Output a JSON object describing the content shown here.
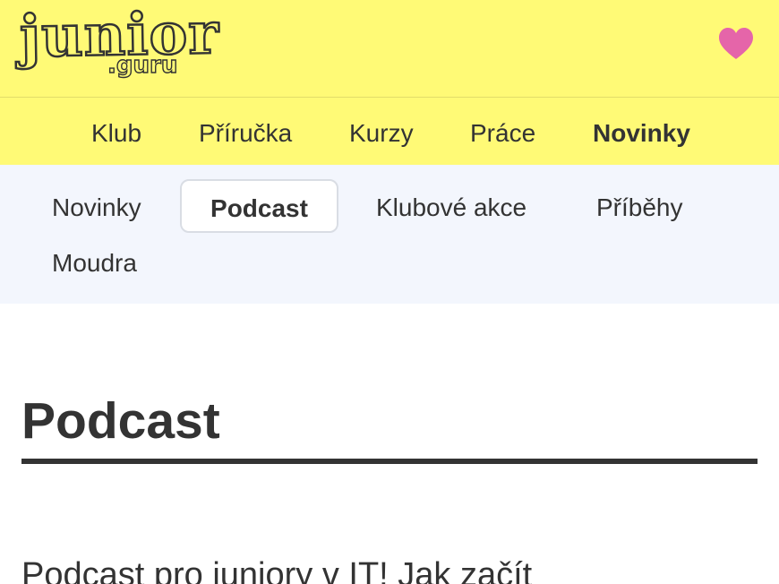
{
  "header": {
    "logo_main": "junior",
    "logo_sub": ".guru",
    "heart_color": "#e565a9",
    "background_color": "#fffa76"
  },
  "main_nav": [
    {
      "label": "Klub",
      "active": false
    },
    {
      "label": "Příručka",
      "active": false
    },
    {
      "label": "Kurzy",
      "active": false
    },
    {
      "label": "Práce",
      "active": false
    },
    {
      "label": "Novinky",
      "active": true
    }
  ],
  "sub_nav": [
    {
      "label": "Novinky",
      "active": false
    },
    {
      "label": "Podcast",
      "active": true
    },
    {
      "label": "Klubové akce",
      "active": false
    },
    {
      "label": "Příběhy",
      "active": false
    },
    {
      "label": "Moudra",
      "active": false
    }
  ],
  "main": {
    "title": "Podcast",
    "subtitle": "Podcast pro juniory v IT! Jak začít"
  }
}
